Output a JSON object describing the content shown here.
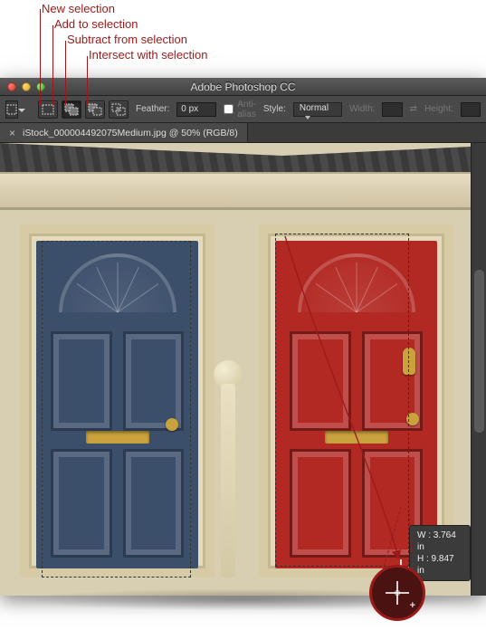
{
  "annotations": {
    "new_selection": "New selection",
    "add_to_selection": "Add to selection",
    "subtract_from_selection": "Subtract from selection",
    "intersect_with_selection": "Intersect with selection"
  },
  "window": {
    "title": "Adobe Photoshop CC"
  },
  "options_bar": {
    "feather_label": "Feather:",
    "feather_value": "0 px",
    "anti_alias_label": "Anti-alias",
    "anti_alias_checked": false,
    "style_label": "Style:",
    "style_value": "Normal",
    "width_label": "Width:",
    "height_label": "Height:"
  },
  "document": {
    "tab_label": "iStock_000004492075Medium.jpg @ 50% (RGB/8)"
  },
  "measurement": {
    "w": "W : 3.764 in",
    "h": "H : 9.847 in"
  }
}
